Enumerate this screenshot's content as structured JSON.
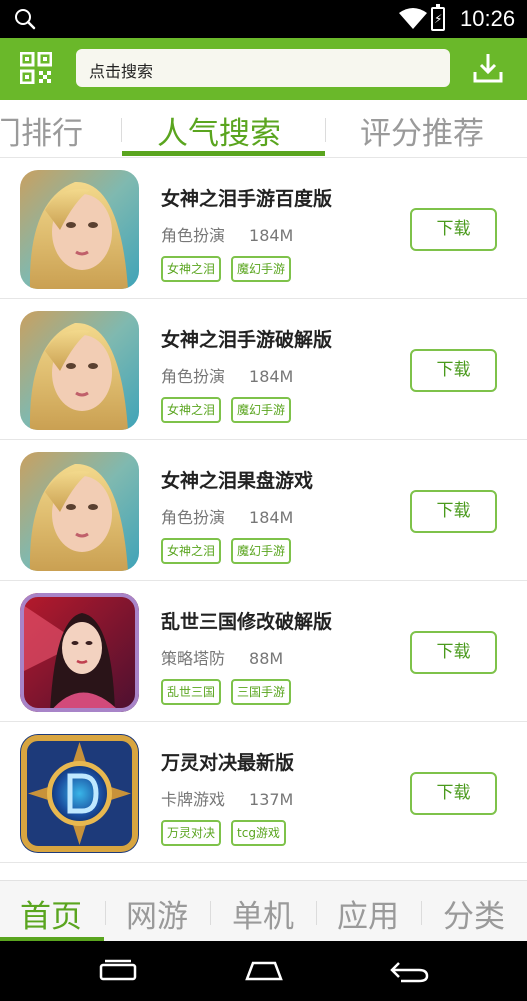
{
  "status_bar": {
    "time": "10:26",
    "icons": [
      "search-icon",
      "wifi-icon",
      "battery-charging-icon"
    ]
  },
  "header": {
    "search_placeholder": "点击搜索",
    "icons": [
      "qr-scan-icon",
      "download-icon"
    ]
  },
  "top_tabs": [
    {
      "label": "热门排行",
      "visible_label": "门排行",
      "active": false
    },
    {
      "label": "人气搜索",
      "active": true
    },
    {
      "label": "评分推荐",
      "active": false
    }
  ],
  "apps": [
    {
      "title": "女神之泪手游百度版",
      "category": "角色扮演",
      "size": "184M",
      "tags": [
        "女神之泪",
        "魔幻手游"
      ],
      "button": "下载",
      "icon": "goddess-game-icon"
    },
    {
      "title": "女神之泪手游破解版",
      "category": "角色扮演",
      "size": "184M",
      "tags": [
        "女神之泪",
        "魔幻手游"
      ],
      "button": "下载",
      "icon": "goddess-game-icon"
    },
    {
      "title": "女神之泪果盘游戏",
      "category": "角色扮演",
      "size": "184M",
      "tags": [
        "女神之泪",
        "魔幻手游"
      ],
      "button": "下载",
      "icon": "goddess-game-icon"
    },
    {
      "title": "乱世三国修改破解版",
      "category": "策略塔防",
      "size": "88M",
      "tags": [
        "乱世三国",
        "三国手游"
      ],
      "button": "下载",
      "icon": "three-kingdoms-game-icon"
    },
    {
      "title": "万灵对决最新版",
      "category": "卡牌游戏",
      "size": "137M",
      "tags": [
        "万灵对决",
        "tcg游戏"
      ],
      "button": "下载",
      "icon": "card-game-emblem-icon"
    }
  ],
  "bottom_nav": [
    {
      "label": "首页",
      "active": true
    },
    {
      "label": "网游",
      "active": false
    },
    {
      "label": "单机",
      "active": false
    },
    {
      "label": "应用",
      "active": false
    },
    {
      "label": "分类",
      "active": false
    }
  ],
  "system_nav": [
    "recents-icon",
    "home-icon",
    "back-icon"
  ],
  "colors": {
    "accent_green": "#6ab82a",
    "active_text_green": "#5aa51f",
    "tag_border": "#7ec24a",
    "status_bar": "#000000"
  }
}
